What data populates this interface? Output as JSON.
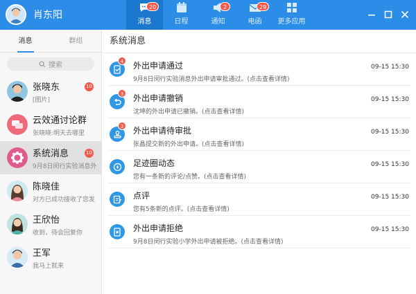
{
  "user": {
    "name": "肖东阳"
  },
  "nav": [
    {
      "label": "消息",
      "badge": "20",
      "icon": "chat-icon",
      "active": true
    },
    {
      "label": "日程",
      "badge": "",
      "icon": "calendar-icon"
    },
    {
      "label": "通知",
      "badge": "2",
      "icon": "speaker-icon"
    },
    {
      "label": "电函",
      "badge": "29",
      "icon": "mail-icon"
    },
    {
      "label": "更多应用",
      "badge": "",
      "icon": "apps-grid-icon"
    }
  ],
  "sidebar": {
    "tabs": [
      {
        "label": "消息"
      },
      {
        "label": "群组"
      }
    ],
    "search_placeholder": "搜索",
    "contacts": [
      {
        "name": "张晓东",
        "message": "[图片]",
        "badge": "10",
        "avatar": "person"
      },
      {
        "name": "云效通讨论群",
        "message": "张晓晓:明天去哪里",
        "badge": "",
        "avatar": "group"
      },
      {
        "name": "系统消息",
        "message": "9月8日闵行实验消息外",
        "badge": "10",
        "avatar": "system"
      },
      {
        "name": "陈晓佳",
        "message": "对方已成功接收了您发",
        "badge": "",
        "avatar": "person"
      },
      {
        "name": "王欣怡",
        "message": "收到，待会回复你",
        "badge": "",
        "avatar": "person"
      },
      {
        "name": "王军",
        "message": "我马上就来",
        "badge": "",
        "avatar": "person"
      }
    ]
  },
  "main": {
    "title": "系统消息",
    "messages": [
      {
        "title": "外出申请通过",
        "detail": "9月8日闵行实验消息外出申请审批通过。(点击查看详情)",
        "time": "09-15  15:30",
        "badge": "4",
        "icon": "doc-check-icon"
      },
      {
        "title": "外出申请撤销",
        "detail": "沈坤的外出申请已撤销。(点击查看详情)",
        "time": "09-15  15:30",
        "badge": "3",
        "icon": "undo-icon"
      },
      {
        "title": "外出申请待审批",
        "detail": "张晶提交新的外出申请。(点击查看详情)",
        "time": "09-15  15:30",
        "badge": "3",
        "icon": "stamp-icon"
      },
      {
        "title": "足迹圈动态",
        "detail": "您有一条新的评论/点赞。(点击查看详情)",
        "time": "09-15  15:30",
        "badge": "",
        "icon": "compass-icon"
      },
      {
        "title": "点评",
        "detail": "您有5条新的点评。(点击查看详情)",
        "time": "09-15  15:30",
        "badge": "",
        "icon": "edit-note-icon"
      },
      {
        "title": "外出申请拒绝",
        "detail": "9月8日闵行实验小学外出申请被拒绝。(点击查看详情)",
        "time": "09-15  15:30",
        "badge": "",
        "icon": "doc-reject-icon"
      }
    ]
  }
}
